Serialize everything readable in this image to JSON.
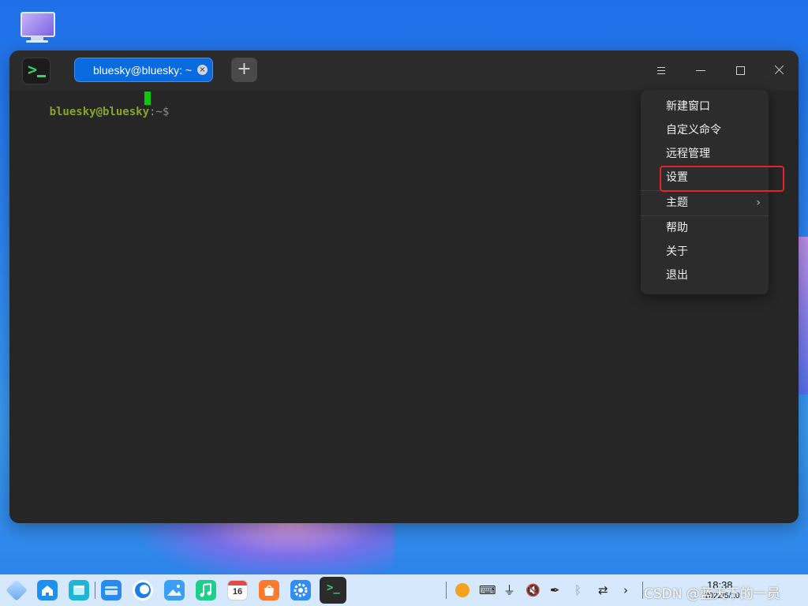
{
  "desktop": {
    "icon_name": "computer-icon"
  },
  "window": {
    "tab_title": "bluesky@bluesky: ~",
    "tab_close_glyph": "×",
    "new_tab_glyph": "+",
    "prompt_user": "bluesky@bluesky",
    "prompt_sep": ":~$"
  },
  "menu": {
    "items": [
      {
        "label": "新建窗口"
      },
      {
        "label": "自定义命令"
      },
      {
        "label": "远程管理"
      },
      {
        "label": "设置"
      },
      {
        "label": "主题",
        "submenu": true
      },
      {
        "label": "帮助"
      },
      {
        "label": "关于"
      },
      {
        "label": "退出"
      }
    ],
    "submenu_arrow": "›",
    "highlighted_item": "设置",
    "highlight_color": "#e8202a"
  },
  "taskbar": {
    "apps": [
      "launcher-icon",
      "home-icon",
      "multitask-icon",
      "file-manager-icon",
      "browser-icon",
      "image-viewer-icon",
      "music-icon",
      "calendar-icon",
      "app-store-icon",
      "settings-icon",
      "terminal-icon"
    ],
    "calendar_day": "16",
    "clock_time": "18:38",
    "clock_date": "2022/5/10",
    "watermark": "CSDN @蓝天下的一员"
  },
  "colors": {
    "accent": "#0a6ae0",
    "terminal_bg": "#262626",
    "prompt_user": "#86a52a",
    "cursor": "#11c511"
  }
}
